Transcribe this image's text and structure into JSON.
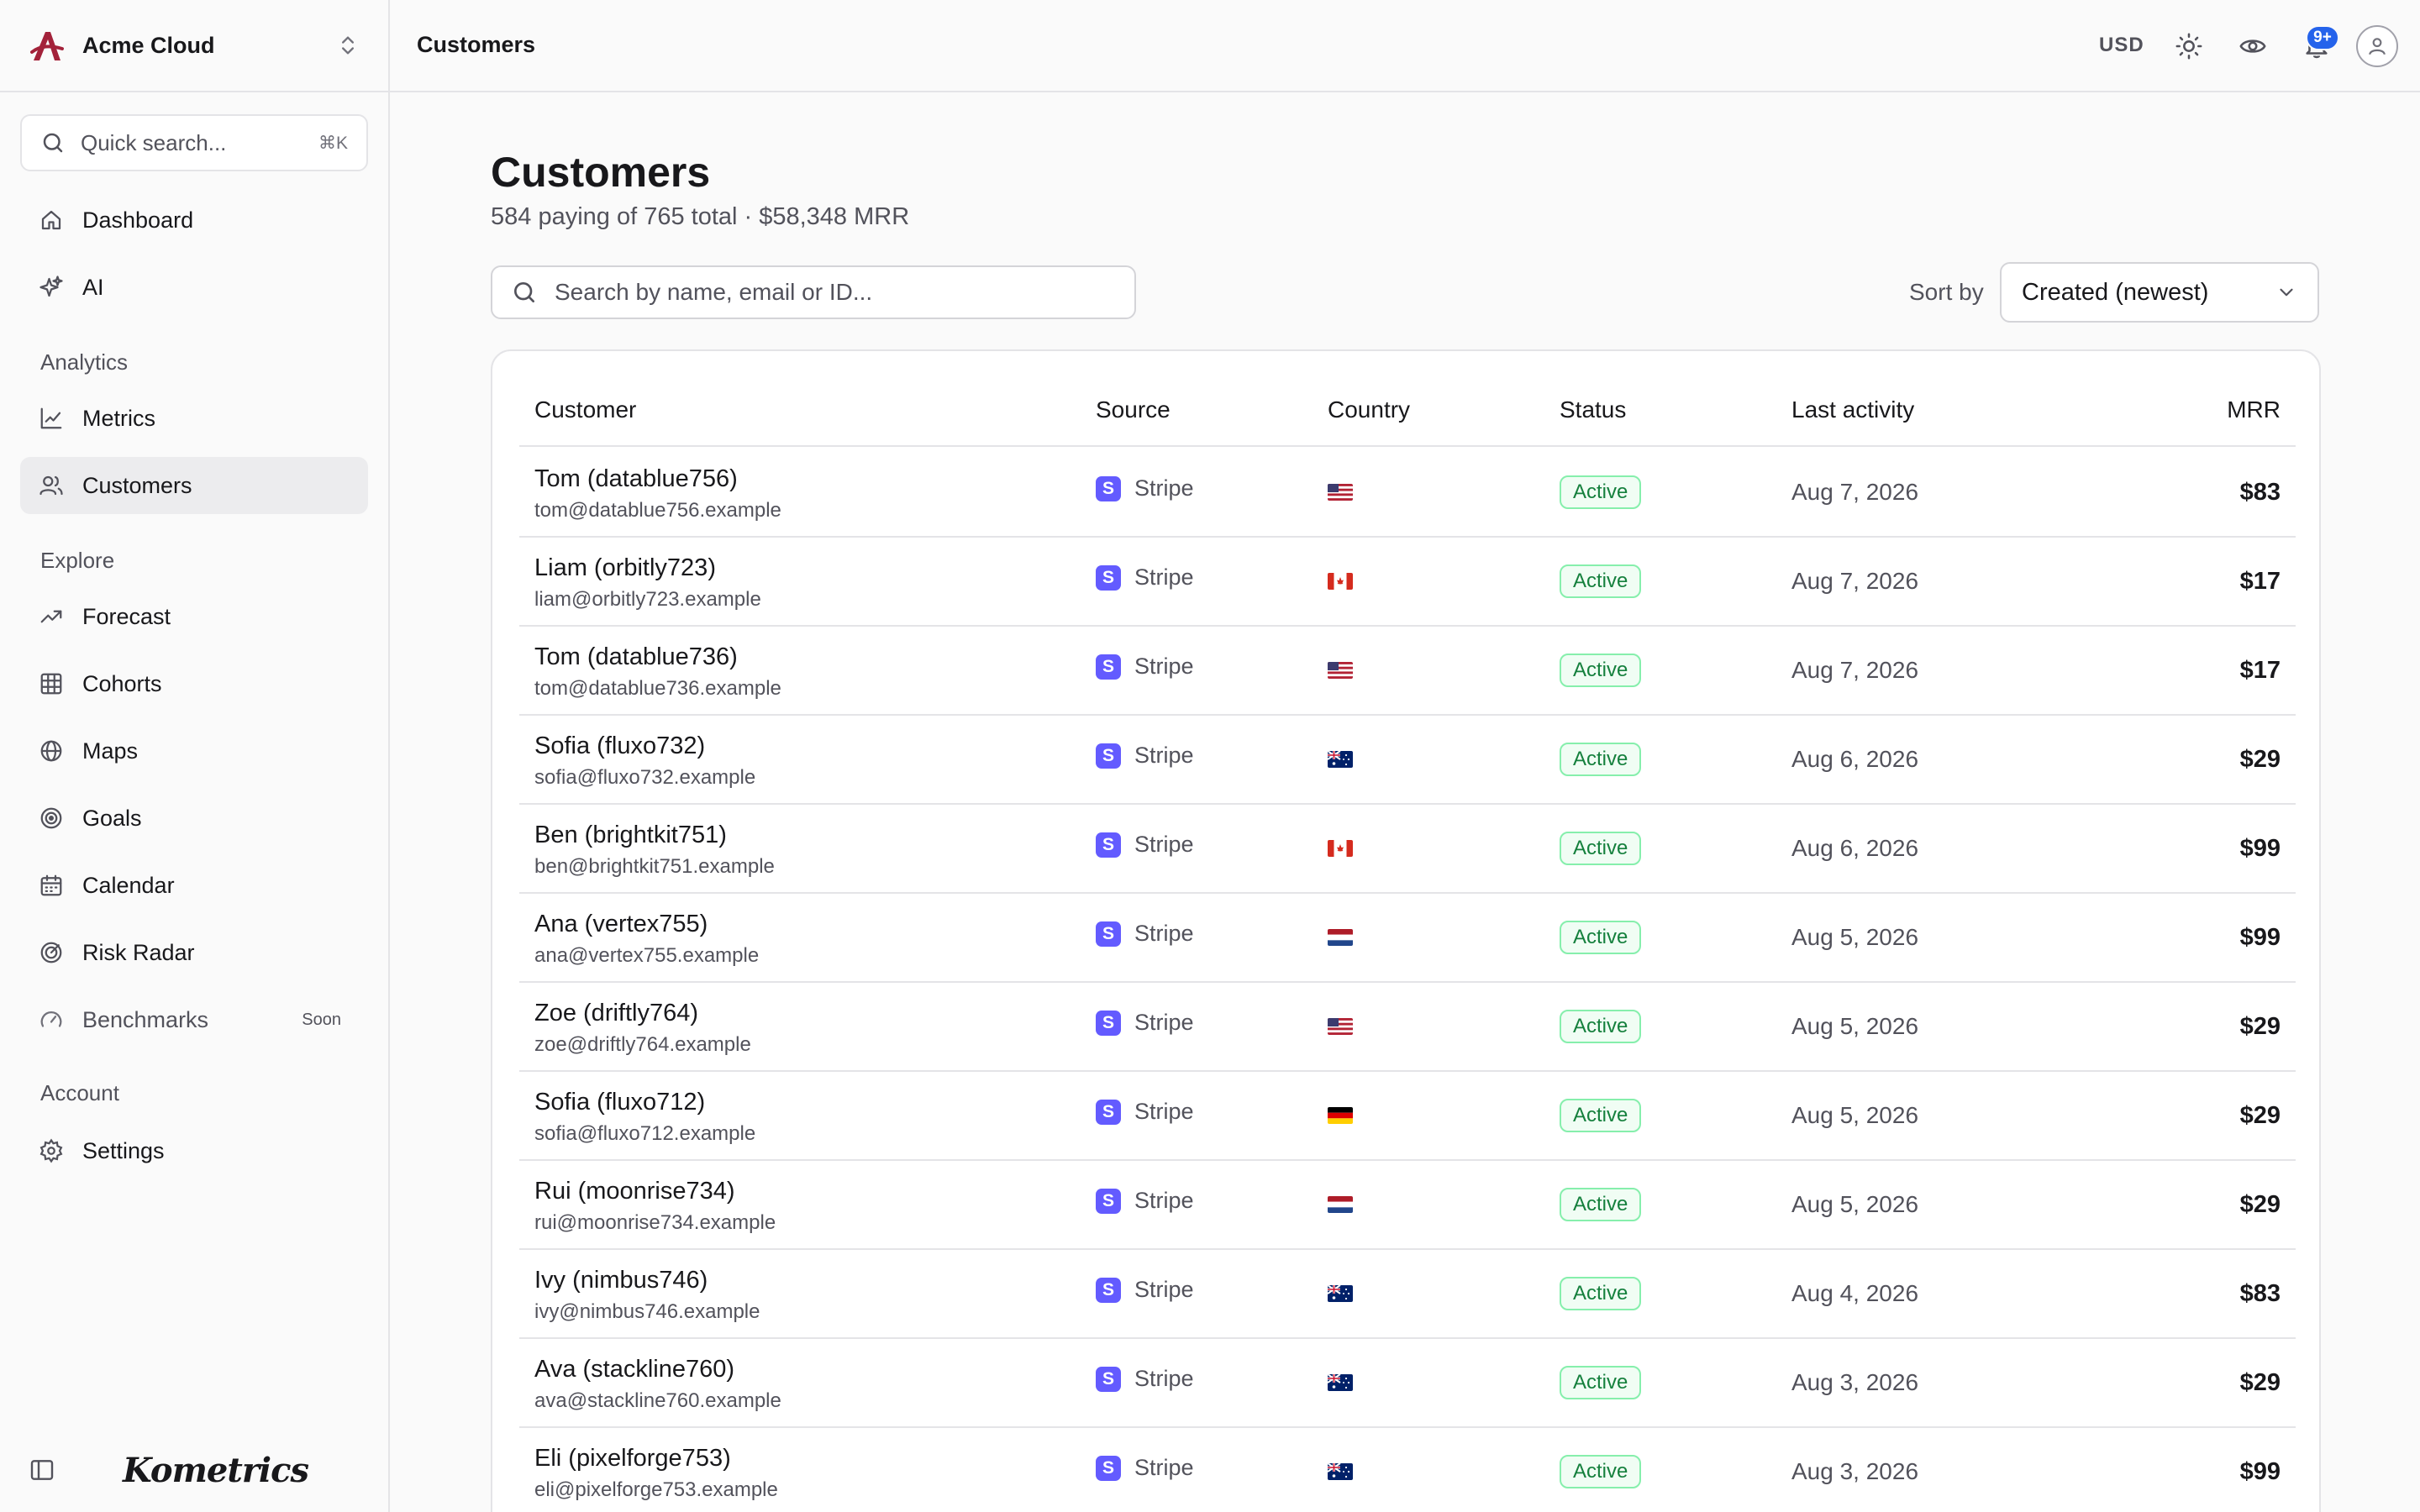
{
  "workspace": {
    "name": "Acme Cloud"
  },
  "sidebar": {
    "search_label": "Quick search...",
    "search_shortcut": "⌘K",
    "items": [
      {
        "label": "Dashboard",
        "icon": "home-icon"
      },
      {
        "label": "AI",
        "icon": "sparkles-icon"
      }
    ],
    "analytics_label": "Analytics",
    "analytics": [
      {
        "label": "Metrics",
        "icon": "line-chart-icon"
      },
      {
        "label": "Customers",
        "icon": "users-icon",
        "active": true
      }
    ],
    "explore_label": "Explore",
    "explore": [
      {
        "label": "Forecast",
        "icon": "trending-up-icon"
      },
      {
        "label": "Cohorts",
        "icon": "grid-icon"
      },
      {
        "label": "Maps",
        "icon": "globe-icon"
      },
      {
        "label": "Goals",
        "icon": "target-icon"
      },
      {
        "label": "Calendar",
        "icon": "calendar-icon"
      },
      {
        "label": "Risk Radar",
        "icon": "radar-icon"
      },
      {
        "label": "Benchmarks",
        "icon": "gauge-icon",
        "badge": "Soon"
      }
    ],
    "account_label": "Account",
    "account": [
      {
        "label": "Settings",
        "icon": "gear-icon"
      }
    ],
    "brand_wordmark": "Kometrics"
  },
  "topbar": {
    "breadcrumb": "Customers",
    "currency": "USD",
    "notifications_badge": "9+"
  },
  "page": {
    "title": "Customers",
    "subtitle": "584 paying of 765 total · $58,348 MRR",
    "search_placeholder": "Search by name, email or ID...",
    "sort_label": "Sort by",
    "sort_value": "Created (newest)"
  },
  "table": {
    "headers": [
      "Customer",
      "Source",
      "Country",
      "Status",
      "Last activity",
      "MRR"
    ],
    "rows": [
      {
        "name": "Tom (datablue756)",
        "email": "tom@datablue756.example",
        "source": "Stripe",
        "country": "US",
        "status": "Active",
        "activity": "Aug 7, 2026",
        "mrr": "$83"
      },
      {
        "name": "Liam (orbitly723)",
        "email": "liam@orbitly723.example",
        "source": "Stripe",
        "country": "CA",
        "status": "Active",
        "activity": "Aug 7, 2026",
        "mrr": "$17"
      },
      {
        "name": "Tom (datablue736)",
        "email": "tom@datablue736.example",
        "source": "Stripe",
        "country": "US",
        "status": "Active",
        "activity": "Aug 7, 2026",
        "mrr": "$17"
      },
      {
        "name": "Sofia (fluxo732)",
        "email": "sofia@fluxo732.example",
        "source": "Stripe",
        "country": "AU",
        "status": "Active",
        "activity": "Aug 6, 2026",
        "mrr": "$29"
      },
      {
        "name": "Ben (brightkit751)",
        "email": "ben@brightkit751.example",
        "source": "Stripe",
        "country": "CA",
        "status": "Active",
        "activity": "Aug 6, 2026",
        "mrr": "$99"
      },
      {
        "name": "Ana (vertex755)",
        "email": "ana@vertex755.example",
        "source": "Stripe",
        "country": "NL",
        "status": "Active",
        "activity": "Aug 5, 2026",
        "mrr": "$99"
      },
      {
        "name": "Zoe (driftly764)",
        "email": "zoe@driftly764.example",
        "source": "Stripe",
        "country": "US",
        "status": "Active",
        "activity": "Aug 5, 2026",
        "mrr": "$29"
      },
      {
        "name": "Sofia (fluxo712)",
        "email": "sofia@fluxo712.example",
        "source": "Stripe",
        "country": "DE",
        "status": "Active",
        "activity": "Aug 5, 2026",
        "mrr": "$29"
      },
      {
        "name": "Rui (moonrise734)",
        "email": "rui@moonrise734.example",
        "source": "Stripe",
        "country": "NL",
        "status": "Active",
        "activity": "Aug 5, 2026",
        "mrr": "$29"
      },
      {
        "name": "Ivy (nimbus746)",
        "email": "ivy@nimbus746.example",
        "source": "Stripe",
        "country": "AU",
        "status": "Active",
        "activity": "Aug 4, 2026",
        "mrr": "$83"
      },
      {
        "name": "Ava (stackline760)",
        "email": "ava@stackline760.example",
        "source": "Stripe",
        "country": "AU",
        "status": "Active",
        "activity": "Aug 3, 2026",
        "mrr": "$29"
      },
      {
        "name": "Eli (pixelforge753)",
        "email": "eli@pixelforge753.example",
        "source": "Stripe",
        "country": "AU",
        "status": "Active",
        "activity": "Aug 3, 2026",
        "mrr": "$99"
      }
    ]
  },
  "colors": {
    "brand_logo": "#a3223a",
    "stripe": "#635bff",
    "notification": "#2563eb",
    "status_active_text": "#15803d",
    "status_active_border": "#86efac",
    "status_active_bg": "#f0fdf4"
  }
}
